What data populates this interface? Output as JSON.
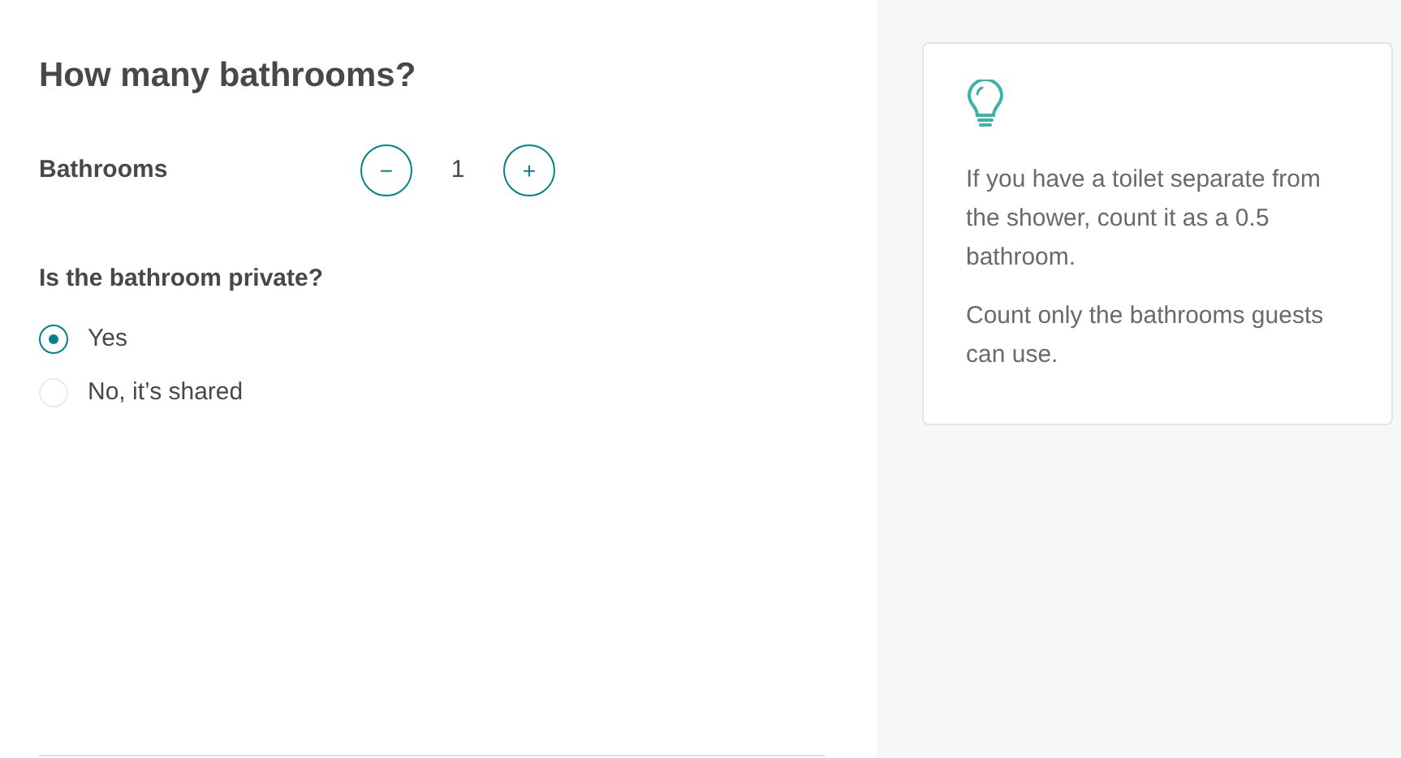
{
  "heading": "How many bathrooms?",
  "counter": {
    "label": "Bathrooms",
    "decrement": "−",
    "value": "1",
    "increment": "+"
  },
  "question": "Is the bathroom private?",
  "options": [
    {
      "label": "Yes",
      "selected": true
    },
    {
      "label": "No, it’s shared",
      "selected": false
    }
  ],
  "tip": {
    "paragraphs": [
      "If you have a toilet separate from the shower, count it as a 0.5 bathroom.",
      "Count only the bathrooms guests can use."
    ]
  }
}
